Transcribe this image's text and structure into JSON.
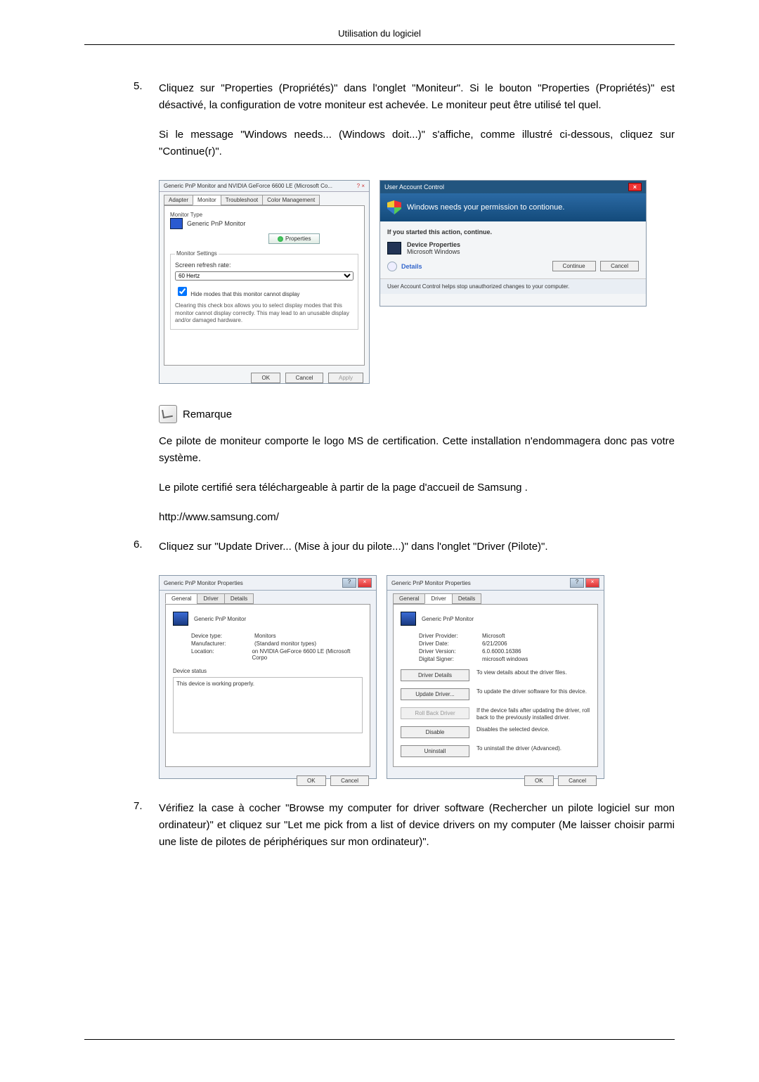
{
  "header": {
    "title": "Utilisation du logiciel"
  },
  "step5": {
    "num": "5.",
    "p1": "Cliquez sur \"Properties (Propriétés)\" dans l'onglet \"Moniteur\". Si le bouton \"Properties (Propriétés)\" est désactivé, la configuration de votre moniteur est achevée. Le moniteur peut être utilisé tel quel.",
    "p2": "Si le message \"Windows needs... (Windows doit...)\" s'affiche, comme illustré ci-dessous, cliquez sur \"Continue(r)\"."
  },
  "dialog1": {
    "title": "Generic PnP Monitor and NVIDIA GeForce 6600 LE (Microsoft Co...",
    "tabs": {
      "adapter": "Adapter",
      "monitor": "Monitor",
      "troubleshoot": "Troubleshoot",
      "color": "Color Management"
    },
    "monitorTypeLabel": "Monitor Type",
    "monitorName": "Generic PnP Monitor",
    "propertiesBtn": "Properties",
    "monitorSettings": "Monitor Settings",
    "refreshLabel": "Screen refresh rate:",
    "refreshValue": "60 Hertz",
    "hideModes": "Hide modes that this monitor cannot display",
    "hideHelp": "Clearing this check box allows you to select display modes that this monitor cannot display correctly. This may lead to an unusable display and/or damaged hardware.",
    "ok": "OK",
    "cancel": "Cancel",
    "apply": "Apply"
  },
  "uac": {
    "title": "User Account Control",
    "headline": "Windows needs your permission to contionue.",
    "started": "If you started this action, continue.",
    "devprops": "Device Properties",
    "mswin": "Microsoft Windows",
    "details": "Details",
    "continue": "Continue",
    "cancel": "Cancel",
    "footer": "User Account Control helps stop unauthorized changes to your computer."
  },
  "remarque": {
    "label": "Remarque",
    "p1": "Ce pilote de moniteur comporte le logo MS de certification. Cette installation n'endommagera donc pas votre système.",
    "p2": "Le pilote certifié sera téléchargeable à partir de la page d'accueil de Samsung .",
    "url": "http://www.samsung.com/"
  },
  "step6": {
    "num": "6.",
    "text": "Cliquez sur \"Update Driver... (Mise à jour du pilote...)\" dans l'onglet \"Driver (Pilote)\"."
  },
  "dlgGeneral": {
    "title": "Generic PnP Monitor Properties",
    "tabs": {
      "general": "General",
      "driver": "Driver",
      "details": "Details"
    },
    "name": "Generic PnP Monitor",
    "devtype_k": "Device type:",
    "devtype_v": "Monitors",
    "manu_k": "Manufacturer:",
    "manu_v": "(Standard monitor types)",
    "loc_k": "Location:",
    "loc_v": "on NVIDIA GeForce 6600 LE (Microsoft Corpo",
    "statusLabel": "Device status",
    "statusText": "This device is working properly.",
    "ok": "OK",
    "cancel": "Cancel"
  },
  "dlgDriver": {
    "title": "Generic PnP Monitor Properties",
    "tabs": {
      "general": "General",
      "driver": "Driver",
      "details": "Details"
    },
    "name": "Generic PnP Monitor",
    "prov_k": "Driver Provider:",
    "prov_v": "Microsoft",
    "date_k": "Driver Date:",
    "date_v": "6/21/2006",
    "ver_k": "Driver Version:",
    "ver_v": "6.0.6000.16386",
    "sign_k": "Digital Signer:",
    "sign_v": "microsoft windows",
    "btnDetails": "Driver Details",
    "descDetails": "To view details about the driver files.",
    "btnUpdate": "Update Driver...",
    "descUpdate": "To update the driver software for this device.",
    "btnRollback": "Roll Back Driver",
    "descRollback": "If the device fails after updating the driver, roll back to the previously installed driver.",
    "btnDisable": "Disable",
    "descDisable": "Disables the selected device.",
    "btnUninstall": "Uninstall",
    "descUninstall": "To uninstall the driver (Advanced).",
    "ok": "OK",
    "cancel": "Cancel"
  },
  "step7": {
    "num": "7.",
    "text": "Vérifiez la case à cocher \"Browse my computer for driver software (Rechercher un pilote logiciel sur mon ordinateur)\" et cliquez sur \"Let me pick from a list of device drivers on my computer (Me laisser choisir parmi une liste de pilotes de périphériques sur mon ordinateur)\"."
  }
}
